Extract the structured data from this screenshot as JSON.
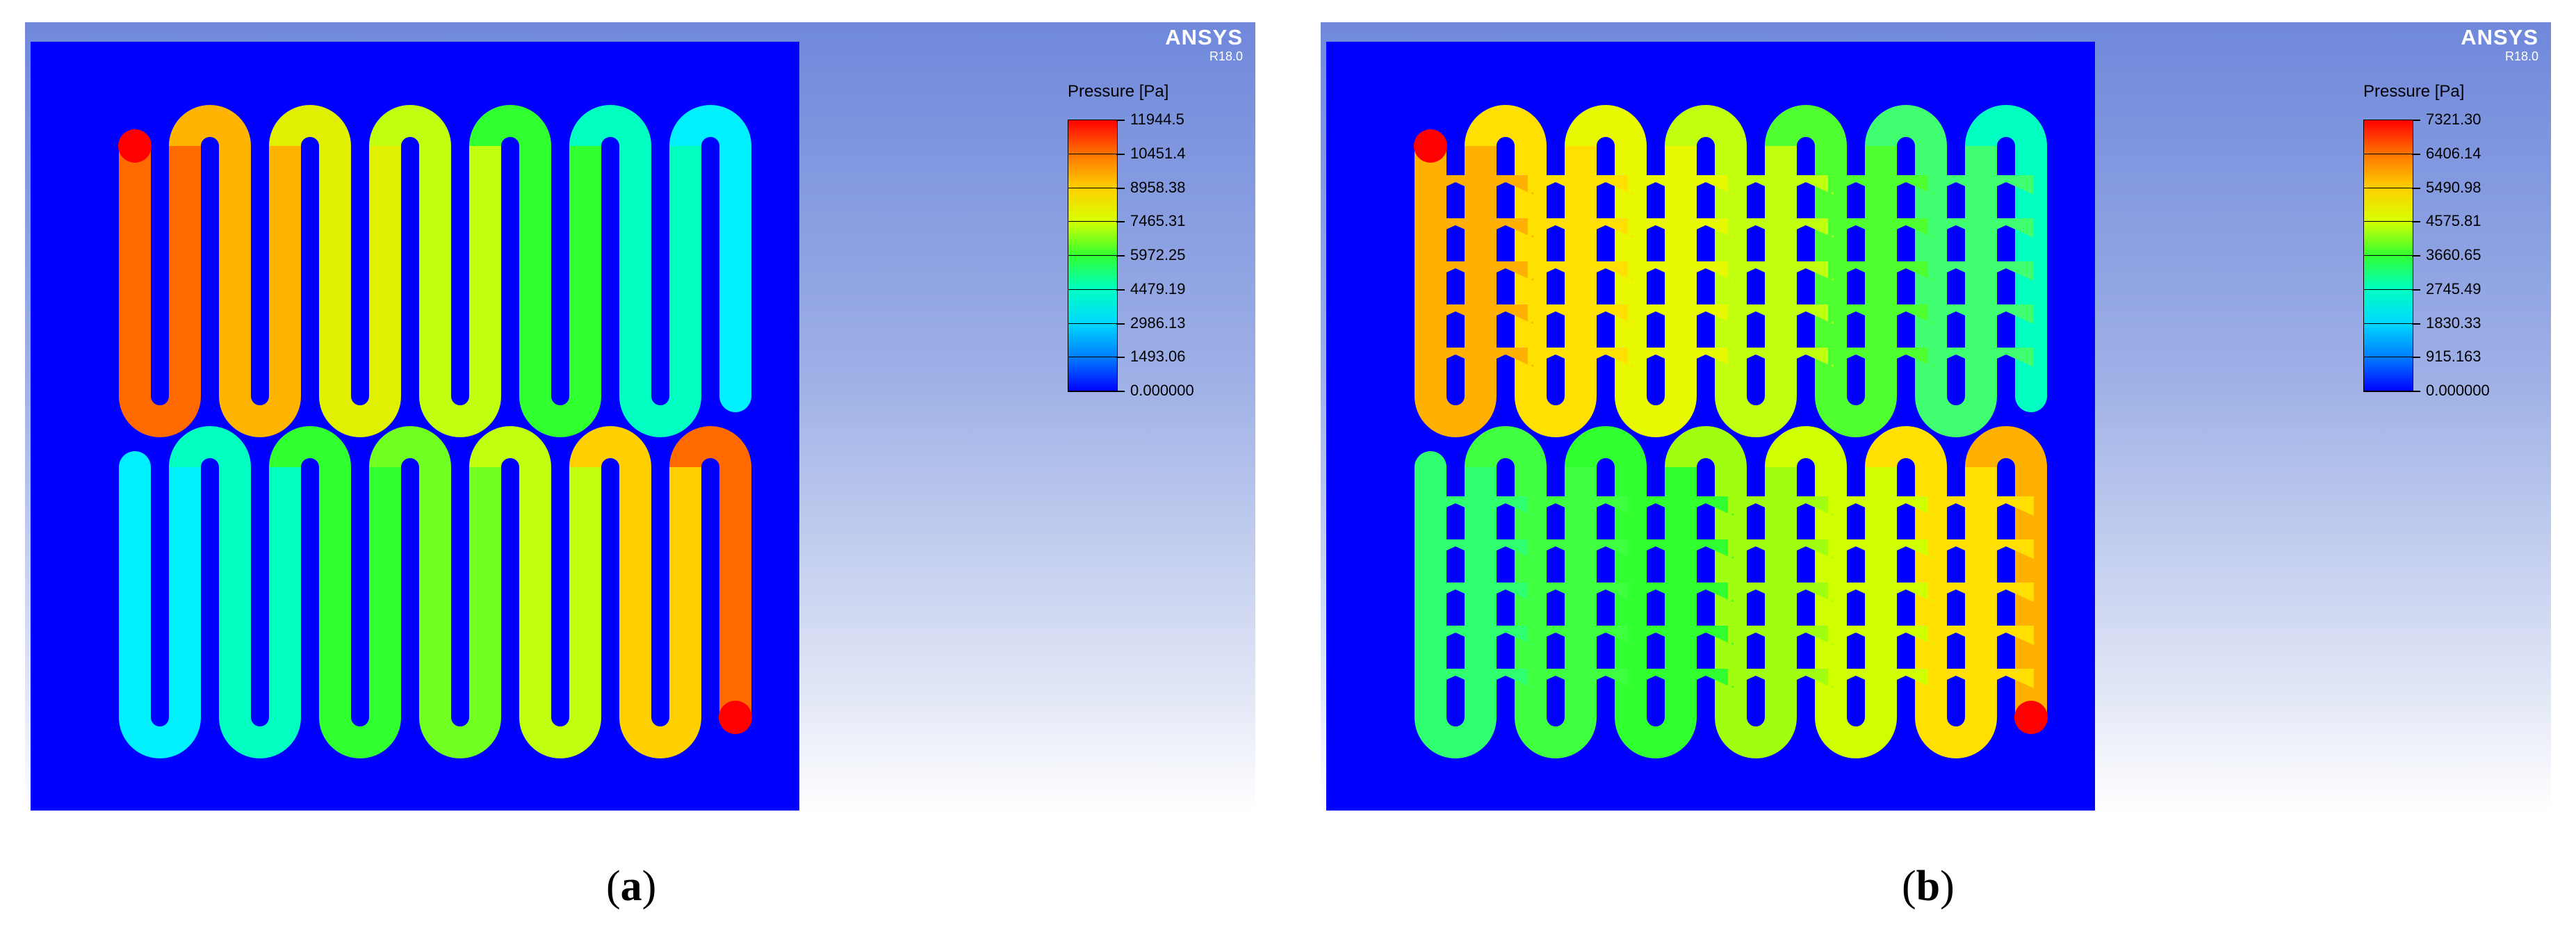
{
  "panels": [
    {
      "id": "a",
      "brand": "ANSYS",
      "version": "R18.0",
      "legend_title": "Pressure [Pa]",
      "legend_labels": [
        "11944.5",
        "10451.4",
        "8958.38",
        "7465.31",
        "5972.25",
        "4479.19",
        "2986.13",
        "1493.06",
        "0.000000"
      ],
      "caption_letter": "a",
      "fins": false,
      "top_loop_colors": [
        "#ff6a00",
        "#ffb400",
        "#e0f000",
        "#c0ff10",
        "#30ff30",
        "#00ffc0",
        "#00f0ff"
      ],
      "bottom_loop_colors": [
        "#00f0ff",
        "#00ffc0",
        "#30ff30",
        "#70ff20",
        "#c0ff10",
        "#ffd000",
        "#ff6a00"
      ]
    },
    {
      "id": "b",
      "brand": "ANSYS",
      "version": "R18.0",
      "legend_title": "Pressure [Pa]",
      "legend_labels": [
        "7321.30",
        "6406.14",
        "5490.98",
        "4575.81",
        "3660.65",
        "2745.49",
        "1830.33",
        "915.163",
        "0.000000"
      ],
      "caption_letter": "b",
      "fins": true,
      "top_loop_colors": [
        "#ffb000",
        "#ffe000",
        "#e8f800",
        "#c0ff10",
        "#50ff30",
        "#40ff70",
        "#00ffc0"
      ],
      "bottom_loop_colors": [
        "#30ff70",
        "#40ff40",
        "#30ff30",
        "#a0ff10",
        "#d0ff00",
        "#ffe000",
        "#ffb000"
      ]
    }
  ],
  "colors": {
    "background_fluid": "#0000ff",
    "inlet_outlet": "#ff0000"
  }
}
